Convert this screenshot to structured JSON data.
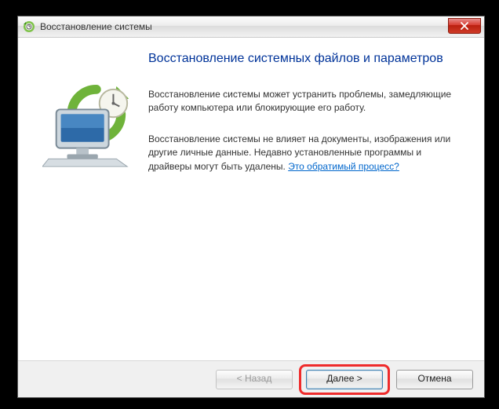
{
  "window": {
    "title": "Восстановление системы"
  },
  "content": {
    "heading": "Восстановление системных файлов и параметров",
    "para1": "Восстановление системы может устранить проблемы, замедляющие работу компьютера или блокирующие его работу.",
    "para2_a": "Восстановление системы не влияет на документы, изображения или другие личные данные. Недавно установленные программы и драйверы могут быть удалены. ",
    "link": "Это обратимый процесс?"
  },
  "buttons": {
    "back": "< Назад",
    "next": "Далее >",
    "cancel": "Отмена"
  }
}
